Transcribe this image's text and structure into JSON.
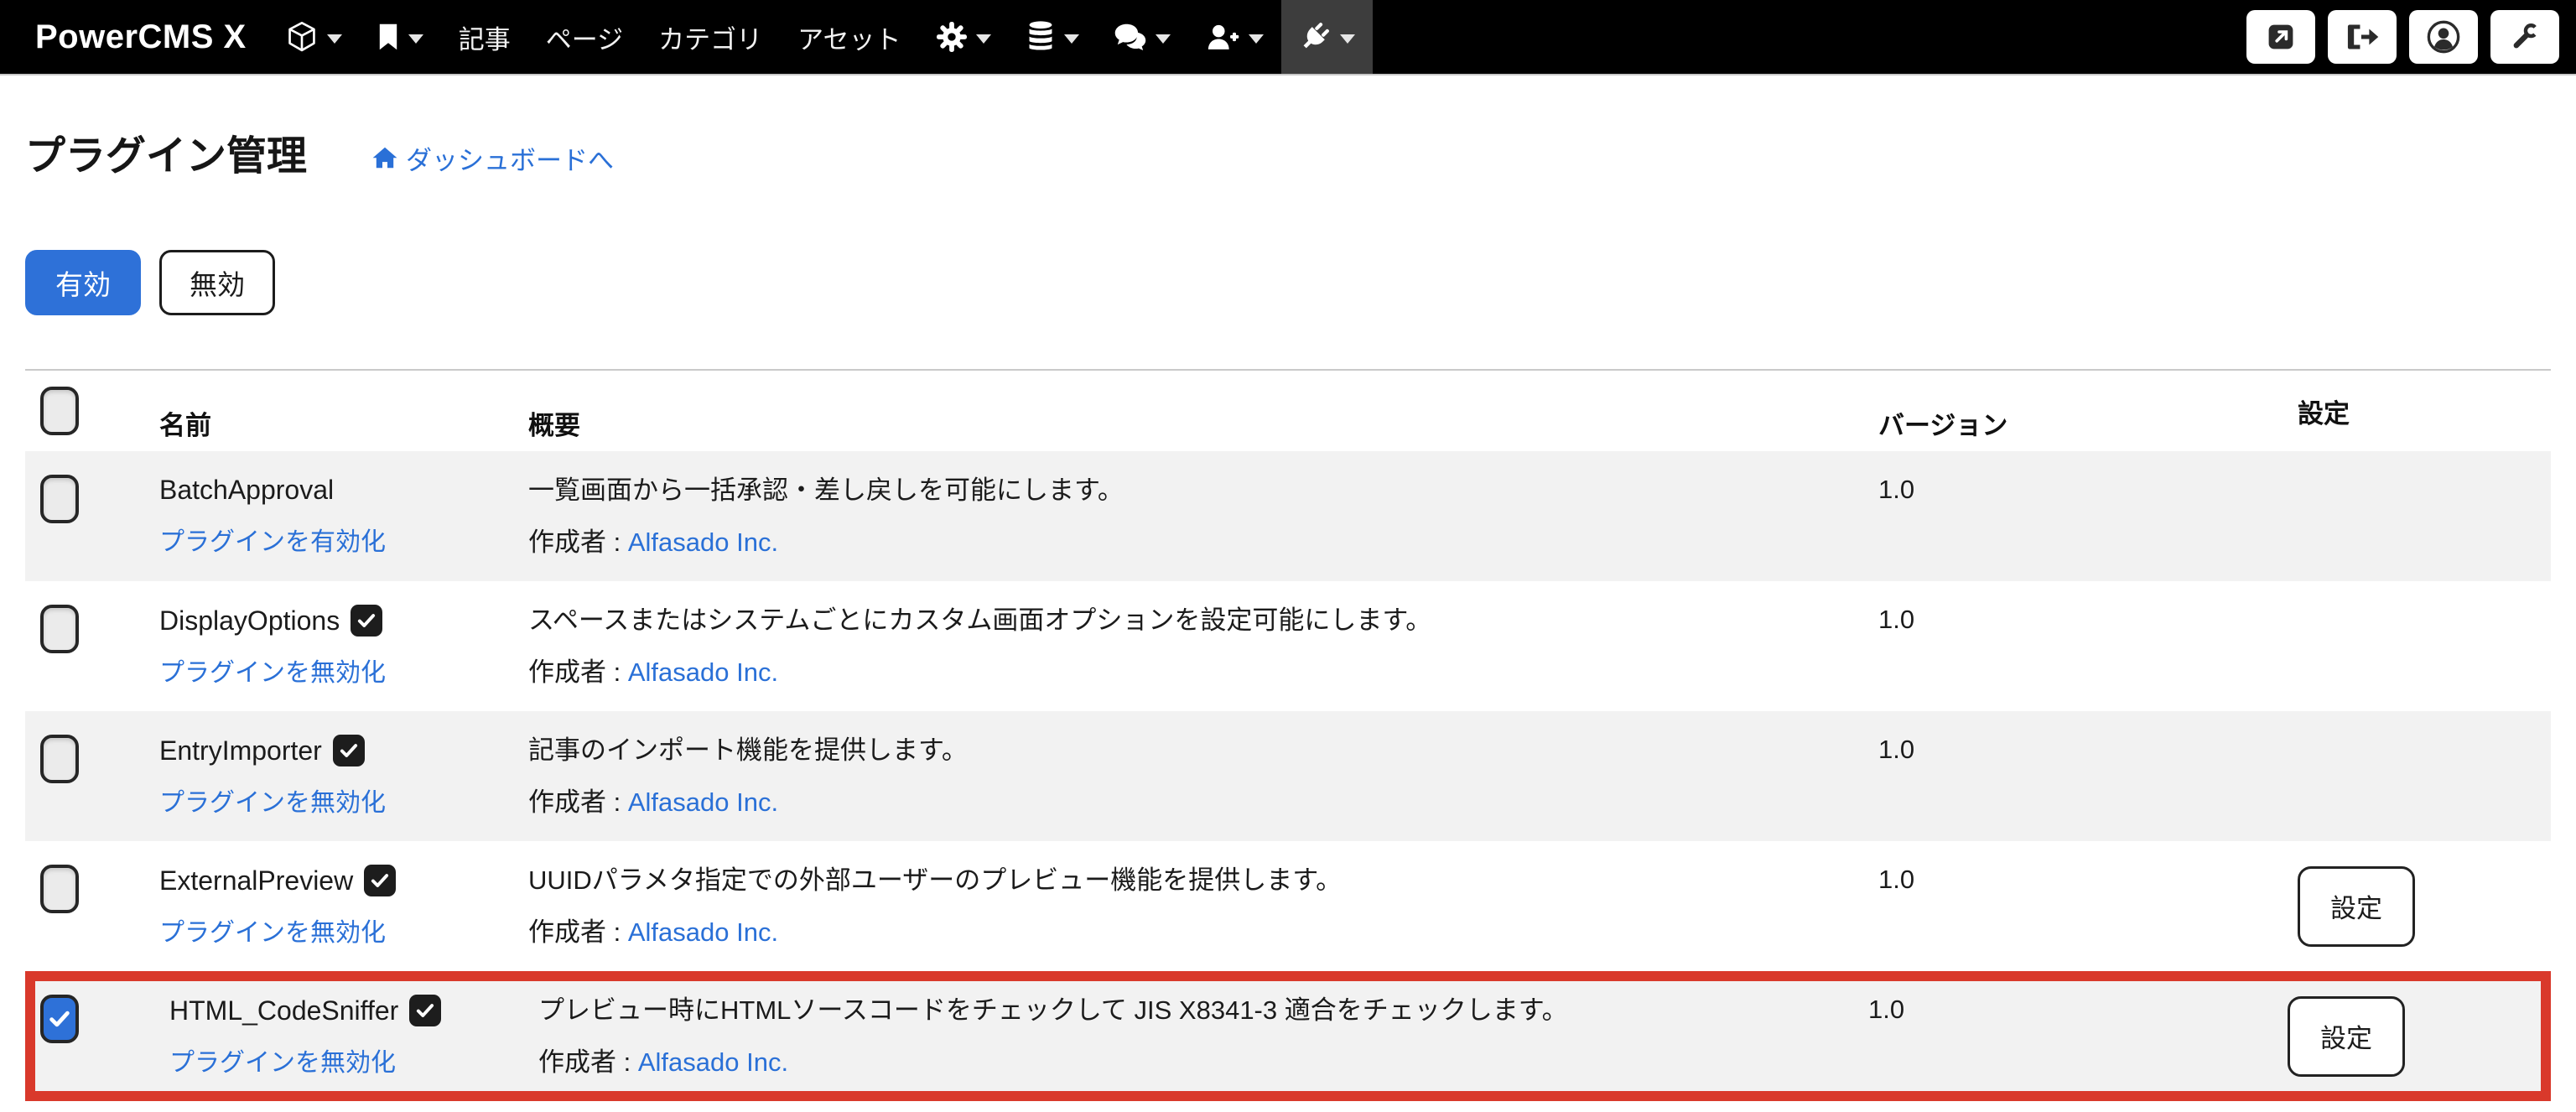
{
  "colors": {
    "navbar_bg": "#000000",
    "nav_active_bg": "#3d3d3d",
    "accent_blue": "#2e71d8",
    "link_blue": "#2a70d7",
    "highlight_red": "#d9392b",
    "row_stripe": "#f2f2f2"
  },
  "icons": {
    "check_glyph": "✓",
    "navbar_icon_menus": [
      "cube-icon",
      "bookmark-icon",
      "gear-icon",
      "database-icon",
      "comments-icon",
      "user-plus-icon",
      "plug-icon"
    ],
    "navbar_right_buttons": [
      "external-link-icon",
      "sign-out-icon",
      "user-circle-icon",
      "wrench-icon"
    ]
  },
  "navbar": {
    "brand": "PowerCMS X",
    "menu_labels": [
      "記事",
      "ページ",
      "カテゴリ",
      "アセット"
    ]
  },
  "header": {
    "title": "プラグイン管理",
    "dashboard_link": "ダッシュボードへ"
  },
  "filters": {
    "active": "有効",
    "inactive": "無効"
  },
  "table": {
    "columns": [
      "名前",
      "概要",
      "バージョン",
      "設定"
    ],
    "author_label": "作成者 :",
    "rows": [
      {
        "name": "BatchApproval",
        "enabled_badge": false,
        "checked": false,
        "toggle_label": "プラグインを有効化",
        "description": "一覧画面から一括承認・差し戻しを可能にします。",
        "author": "Alfasado Inc.",
        "version": "1.0",
        "has_settings": false
      },
      {
        "name": "DisplayOptions",
        "enabled_badge": true,
        "checked": false,
        "toggle_label": "プラグインを無効化",
        "description": "スペースまたはシステムごとにカスタム画面オプションを設定可能にします。",
        "author": "Alfasado Inc.",
        "version": "1.0",
        "has_settings": false
      },
      {
        "name": "EntryImporter",
        "enabled_badge": true,
        "checked": false,
        "toggle_label": "プラグインを無効化",
        "description": "記事のインポート機能を提供します。",
        "author": "Alfasado Inc.",
        "version": "1.0",
        "has_settings": false
      },
      {
        "name": "ExternalPreview",
        "enabled_badge": true,
        "checked": false,
        "toggle_label": "プラグインを無効化",
        "description": "UUIDパラメタ指定での外部ユーザーのプレビュー機能を提供します。",
        "author": "Alfasado Inc.",
        "version": "1.0",
        "has_settings": true,
        "settings_label": "設定"
      },
      {
        "name": "HTML_CodeSniffer",
        "enabled_badge": true,
        "checked": true,
        "highlighted": true,
        "toggle_label": "プラグインを無効化",
        "description": "プレビュー時にHTMLソースコードをチェックして JIS X8341-3 適合をチェックします。",
        "author": "Alfasado Inc.",
        "version": "1.0",
        "has_settings": true,
        "settings_label": "設定"
      }
    ]
  }
}
